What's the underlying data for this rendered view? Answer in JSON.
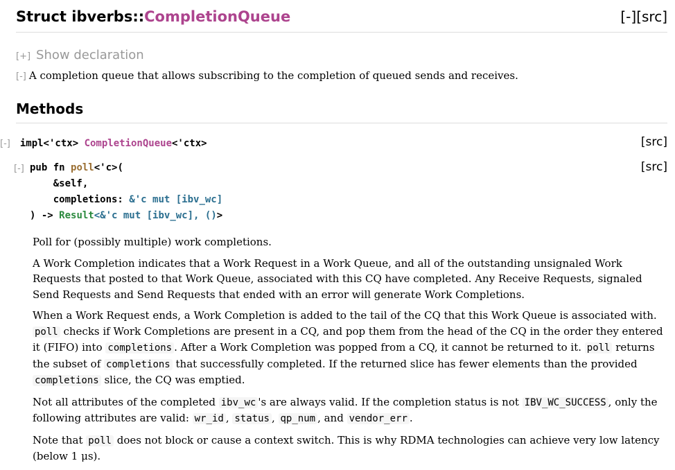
{
  "header": {
    "kind": "Struct",
    "path": "ibverbs::",
    "name": "CompletionQueue",
    "collapse": "[-]",
    "src": "[src]"
  },
  "declaration": {
    "toggle": "[+]",
    "label": "Show declaration"
  },
  "summary": {
    "toggle": "[-]",
    "text": "A completion queue that allows subscribing to the completion of queued sends and receives."
  },
  "methods_heading": "Methods",
  "impl": {
    "toggle": "[-]",
    "prefix": "impl<'ctx> ",
    "type": "CompletionQueue",
    "suffix": "<'ctx>",
    "src": "[src]"
  },
  "method": {
    "toggle": "[-]",
    "src": "[src]",
    "sig": {
      "pub_fn": "pub fn ",
      "name": "poll",
      "generics": "<'c>(",
      "self_line": "    &self,",
      "arg_name": "    completions: ",
      "arg_ref": "&'c mut [",
      "arg_type": "ibv_wc",
      "arg_close": "]",
      "ret_open": ") -> ",
      "ret_type": "Result",
      "ret_generic": "<&'c mut [",
      "ret_inner": "ibv_wc",
      "ret_mid": "], ",
      "ret_unit": "()",
      "ret_close": ">"
    }
  },
  "docs": {
    "p1": "Poll for (possibly multiple) work completions.",
    "p2": "A Work Completion indicates that a Work Request in a Work Queue, and all of the outstanding unsignaled Work Requests that posted to that Work Queue, associated with this CQ have completed. Any Receive Requests, signaled Send Requests and Send Requests that ended with an error will generate Work Completions.",
    "p3a": "When a Work Request ends, a Work Completion is added to the tail of the CQ that this Work Queue is associated with. ",
    "p3_code1": "poll",
    "p3b": " checks if Work Completions are present in a CQ, and pop them from the head of the CQ in the order they entered it (FIFO) into ",
    "p3_code2": "completions",
    "p3c": ". After a Work Completion was popped from a CQ, it cannot be returned to it. ",
    "p3_code3": "poll",
    "p3d": " returns the subset of ",
    "p3_code4": "completions",
    "p3e": " that successfully completed. If the returned slice has fewer elements than the provided ",
    "p3_code5": "completions",
    "p3f": " slice, the CQ was emptied.",
    "p4a": "Not all attributes of the completed ",
    "p4_code1": "ibv_wc",
    "p4b": "'s are always valid. If the completion status is not ",
    "p4_code2": "IBV_WC_SUCCESS",
    "p4c": ", only the following attributes are valid: ",
    "p4_code3": "wr_id",
    "p4d": ", ",
    "p4_code4": "status",
    "p4e": ", ",
    "p4_code5": "qp_num",
    "p4f": ", and ",
    "p4_code6": "vendor_err",
    "p4g": ".",
    "p5a": "Note that ",
    "p5_code1": "poll",
    "p5b": " does not block or cause a context switch. This is why RDMA technologies can achieve very low latency (below 1 μs)."
  }
}
